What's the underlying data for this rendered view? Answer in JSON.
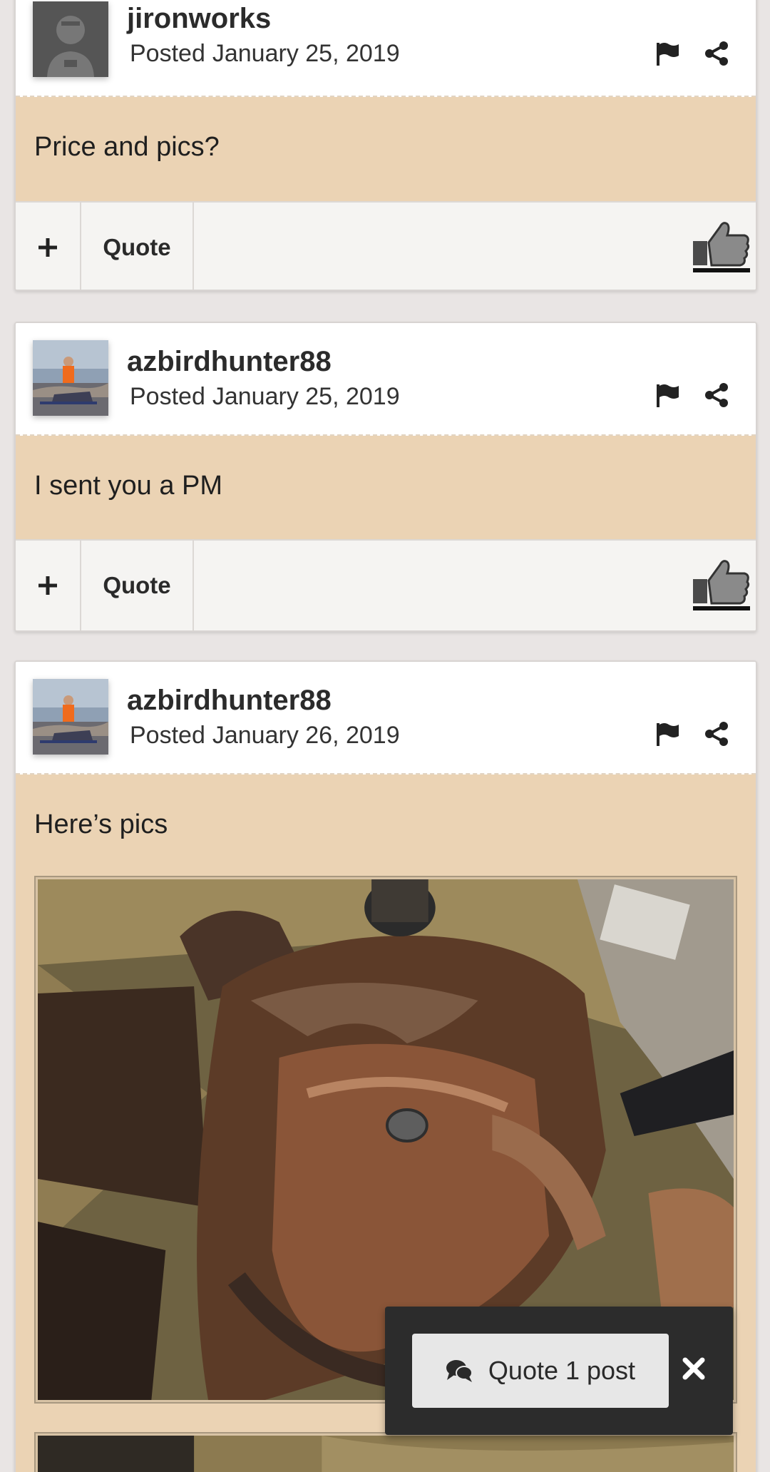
{
  "posts": [
    {
      "author": "jironworks",
      "posted_label": "Posted",
      "date": "January 25, 2019",
      "body": "Price and pics?",
      "avatar": "default-user-avatar"
    },
    {
      "author": "azbirdhunter88",
      "posted_label": "Posted",
      "date": "January 25, 2019",
      "body": "I sent you a PM",
      "avatar": "hunter-photo-avatar"
    },
    {
      "author": "azbirdhunter88",
      "posted_label": "Posted",
      "date": "January 26, 2019",
      "body": "Here’s pics",
      "avatar": "hunter-photo-avatar"
    }
  ],
  "footer": {
    "quote_label": "Quote",
    "plus_icon": "plus-icon",
    "like_icon": "thumbs-up-icon"
  },
  "header_icons": [
    "flag-icon",
    "share-icon"
  ],
  "quote_popup": {
    "label": "Quote 1 post",
    "icon": "comments-icon",
    "close_icon": "close-icon"
  },
  "colors": {
    "page_bg": "#e9e5e4",
    "post_body_bg": "#ebd3b4",
    "footer_bg": "#f5f4f2",
    "popup_bg": "#2c2c2c"
  }
}
